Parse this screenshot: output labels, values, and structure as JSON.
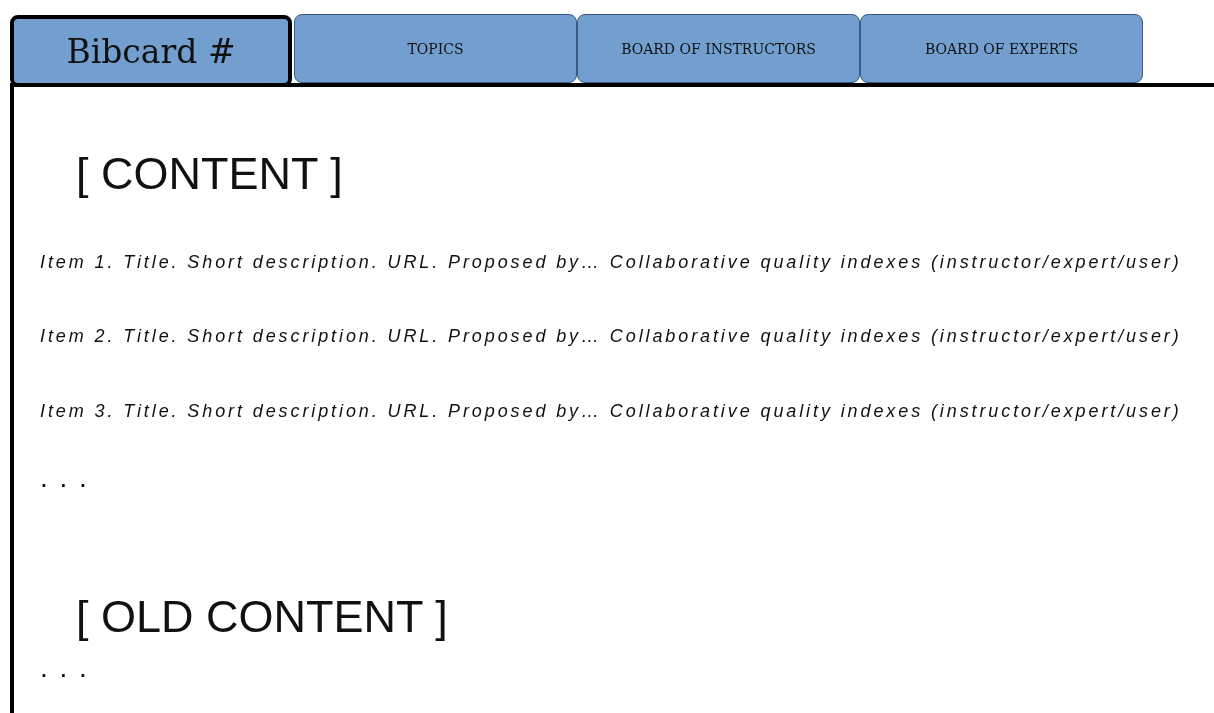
{
  "tabs": [
    {
      "label": "Bibcard #",
      "selected": true
    },
    {
      "label": "TOPICS",
      "selected": false
    },
    {
      "label": "BOARD OF INSTRUCTORS",
      "selected": false
    },
    {
      "label": "BOARD OF EXPERTS",
      "selected": false
    }
  ],
  "sections": [
    {
      "heading": "[ CONTENT ]",
      "items": [
        "Item 1. Title. Short description. URL. Proposed by… Collaborative quality indexes (instructor/expert/user)",
        "Item 2. Title. Short description. URL. Proposed by… Collaborative quality indexes (instructor/expert/user)",
        "Item 3. Title. Short description. URL. Proposed by… Collaborative quality indexes (instructor/expert/user)"
      ],
      "more": ". . ."
    },
    {
      "heading": "[ OLD CONTENT ]",
      "more": ". . ."
    }
  ]
}
